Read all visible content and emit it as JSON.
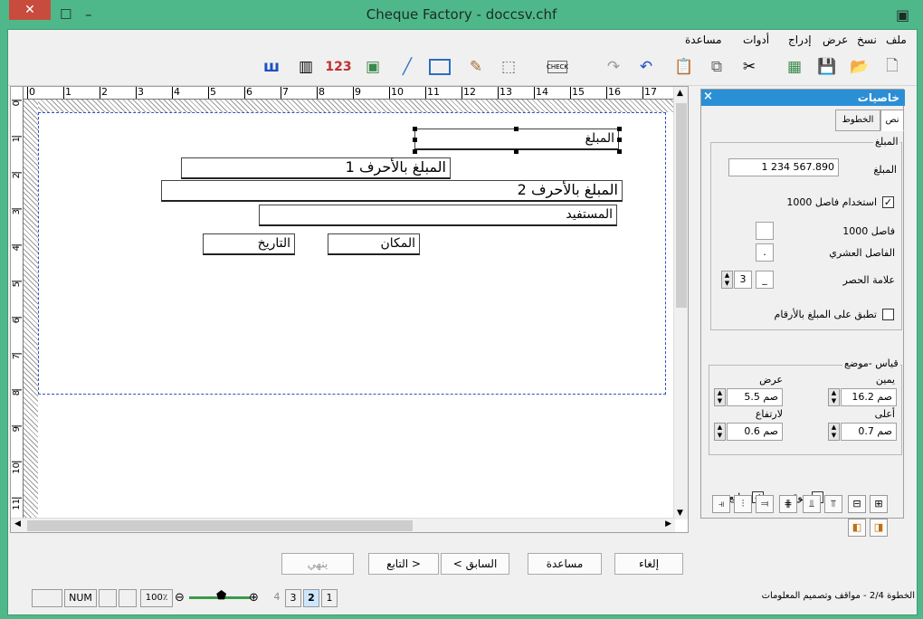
{
  "window": {
    "title": "Cheque Factory - doccsv.chf",
    "close_symbol": "✕",
    "restore_symbol": "☐",
    "minimize_symbol": "–"
  },
  "menu": [
    "ملف",
    "نسخ",
    "عرض",
    "إدراج",
    "أدوات",
    "مساعدة"
  ],
  "toolbar": {
    "icons": [
      "new-icon",
      "open-icon",
      "save-icon",
      "image-icon",
      "cut-icon",
      "copy-icon",
      "paste-icon",
      "undo-icon",
      "redo-icon",
      "cheque-icon",
      "text-frame-icon",
      "edit-icon",
      "rectangle-icon",
      "line-icon",
      "picture-icon",
      "number-icon",
      "barcode-icon",
      "bar-chart-icon"
    ],
    "number_label": "123",
    "cheque_label": "CHECK"
  },
  "ruler": {
    "h": [
      "0",
      "1",
      "2",
      "3",
      "4",
      "5",
      "6",
      "7",
      "8",
      "9",
      "10",
      "11",
      "12",
      "13",
      "14",
      "15",
      "16",
      "17"
    ],
    "v": [
      "0",
      "1",
      "2",
      "3",
      "4",
      "5",
      "6",
      "7",
      "8",
      "9",
      "10",
      "11"
    ]
  },
  "fields": {
    "amount": "المبلغ",
    "words1": "المبلغ بالأحرف 1",
    "words2": "المبلغ بالأحرف 2",
    "payee": "المستفيد",
    "place": "المكان",
    "date": "التاريخ"
  },
  "panel": {
    "title": "خاصيات",
    "close": "×",
    "tabs": [
      "نص",
      "الخطوط"
    ],
    "amount_group": "المبلغ",
    "amount_label": "المبلغ",
    "amount_value": "1 234 567.890",
    "use_separator_label": "استخدام فاصل 1000",
    "use_separator_checked": true,
    "separator_label": "فاصل 1000",
    "separator_value": "",
    "decimal_label": "الفاصل العشري",
    "decimal_value": ".",
    "limit_label": "علامة الحصر",
    "limit_count": "3",
    "limit_char": "_",
    "apply_label": "تطبق على المبلغ بالأرقام",
    "apply_checked": false,
    "measure_group": "قياس -موضع",
    "width_label": "عرض",
    "width_value": "5.5 صم",
    "right_label": "يمين",
    "right_value": "16.2 صم",
    "height_label": "لارتفاع",
    "height_value": "0.6 صم",
    "top_label": "أعلى",
    "top_value": "0.7 صم",
    "print_label": "يطبع",
    "print_checked": true,
    "lock_label": "موقف",
    "lock_checked": false
  },
  "buttons": {
    "cancel": "إلغاء",
    "help": "مساعدة",
    "prev": "< السابق",
    "next": "التابع >",
    "finish": "ينهي"
  },
  "status": {
    "num": "NUM",
    "zoom": "100٪",
    "pages": [
      "4",
      "3",
      "2",
      "1"
    ],
    "active_page": "2",
    "step": "الخطوة 2/4 - مواقف وتصميم المعلومات"
  }
}
